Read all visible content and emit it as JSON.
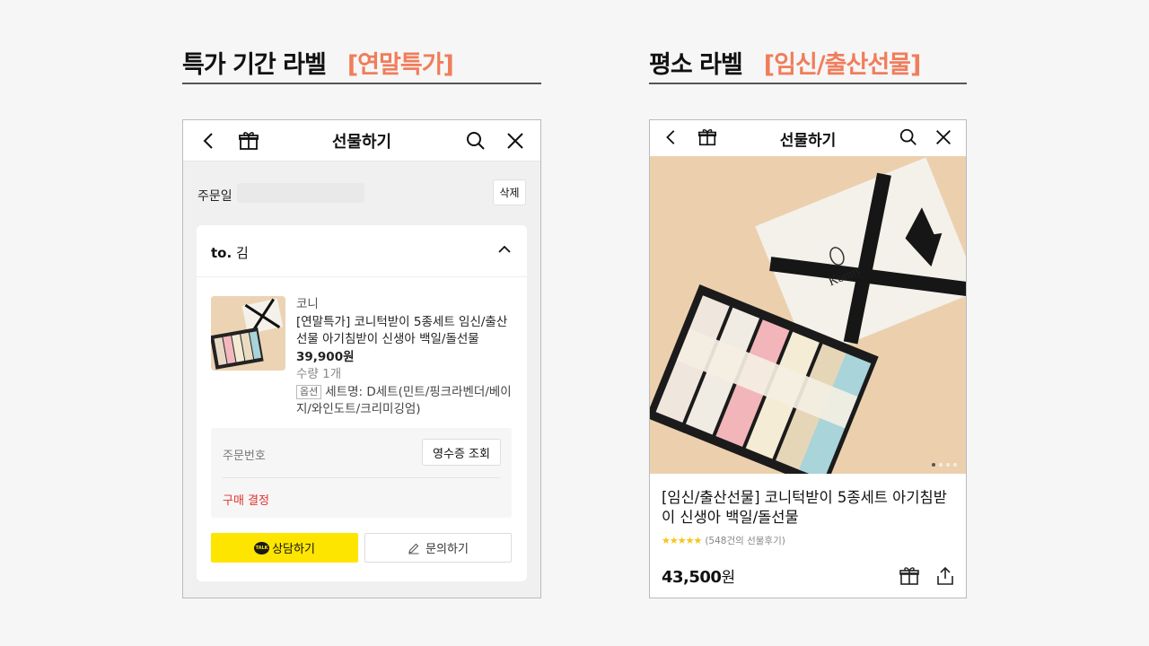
{
  "left_caption": {
    "title": "특가 기간 라벨",
    "tag": "[연말특가]"
  },
  "right_caption": {
    "title": "평소 라벨",
    "tag": "[임신/출산선물]"
  },
  "left_screen": {
    "header": {
      "title": "선물하기"
    },
    "order_date_label": "주문일",
    "delete_label": "삭제",
    "recipient": {
      "prefix": "to.",
      "name": "김"
    },
    "product": {
      "brand": "코니",
      "name": "[연말특가] 코니턱받이 5종세트 임신/출산선물 아기침받이 신생아 백일/돌선물",
      "price": "39,900원",
      "quantity": "수량 1개",
      "option_badge": "옵션",
      "option_text": "세트명: D세트(민트/핑크라벤더/베이지/와인도트/크리미깅엄)"
    },
    "order_number_label": "주문번호",
    "receipt_button": "영수증 조회",
    "purchase_status": "구매 결정",
    "chat_button": "상담하기",
    "talk_badge": "TALK",
    "inquiry_button": "문의하기"
  },
  "right_screen": {
    "header": {
      "title": "선물하기"
    },
    "product_title": "[임신/출산선물] 코니턱받이 5종세트 아기침받이 신생아 백일/돌선물",
    "rating_stars": "★★★★★",
    "review_count": "(548건의 선물후기)",
    "price_value": "43,500",
    "price_unit": "원",
    "image_dots": {
      "total": 4,
      "active": 0
    },
    "box_brand": "Konny"
  },
  "colors": {
    "accent_label": "#f07d5b",
    "kakao_yellow": "#fee500",
    "status_red": "#e0342f",
    "star": "#f5c518"
  }
}
